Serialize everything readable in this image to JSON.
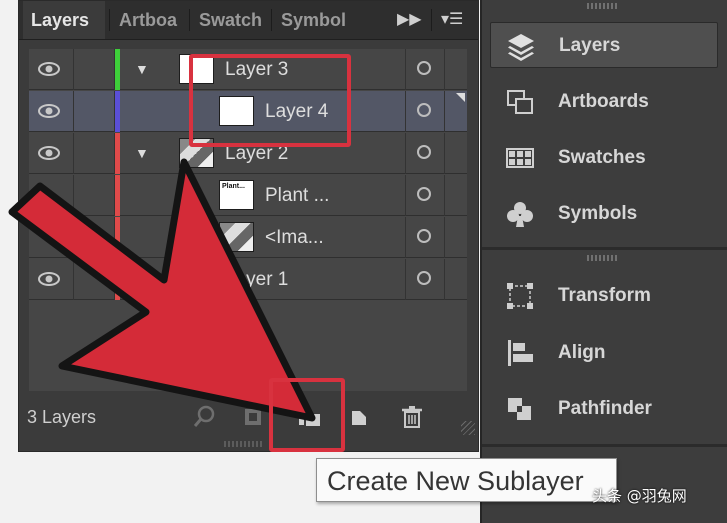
{
  "tabs": [
    {
      "label": "Layers",
      "active": true
    },
    {
      "label": "Artboa",
      "active": false
    },
    {
      "label": "Swatch",
      "active": false
    },
    {
      "label": "Symbol",
      "active": false
    }
  ],
  "tab_glyphs": {
    "expand": "▶▶",
    "menu": "▾☰"
  },
  "layers": [
    {
      "name": "Layer 3",
      "color": "#3ecf3a",
      "visible": true,
      "expanded": true,
      "thumb": "blank"
    },
    {
      "name": "Layer 4",
      "color": "#5a4fd8",
      "visible": true,
      "thumb": "blank",
      "selected": true
    },
    {
      "name": "Layer 2",
      "color": "#e04a4a",
      "visible": true,
      "expanded": true,
      "thumb": "photo"
    },
    {
      "name": "Plant ...",
      "color": "#e04a4a",
      "visible": false,
      "thumb": "text",
      "thumb_text": "Plant..."
    },
    {
      "name": "<Ima...",
      "color": "#e04a4a",
      "visible": false,
      "thumb": "photo"
    },
    {
      "name": "Layer 1",
      "color": "#e04a4a",
      "visible": true,
      "thumb": "photo"
    }
  ],
  "footer": {
    "layer_count": "3 Layers"
  },
  "dock": {
    "group1": [
      {
        "label": "Layers",
        "icon": "layers-stack-icon",
        "active": true
      },
      {
        "label": "Artboards",
        "icon": "artboards-icon"
      },
      {
        "label": "Swatches",
        "icon": "swatches-grid-icon"
      },
      {
        "label": "Symbols",
        "icon": "club-symbol-icon"
      }
    ],
    "group2": [
      {
        "label": "Transform",
        "icon": "transform-icon"
      },
      {
        "label": "Align",
        "icon": "align-icon"
      },
      {
        "label": "Pathfinder",
        "icon": "pathfinder-icon"
      }
    ]
  },
  "tooltip": {
    "text": "Create New Sublayer"
  },
  "watermark": "头条 @羽兔网",
  "colors": {
    "highlight": "#d8323f",
    "arrow": "#d42b38"
  }
}
